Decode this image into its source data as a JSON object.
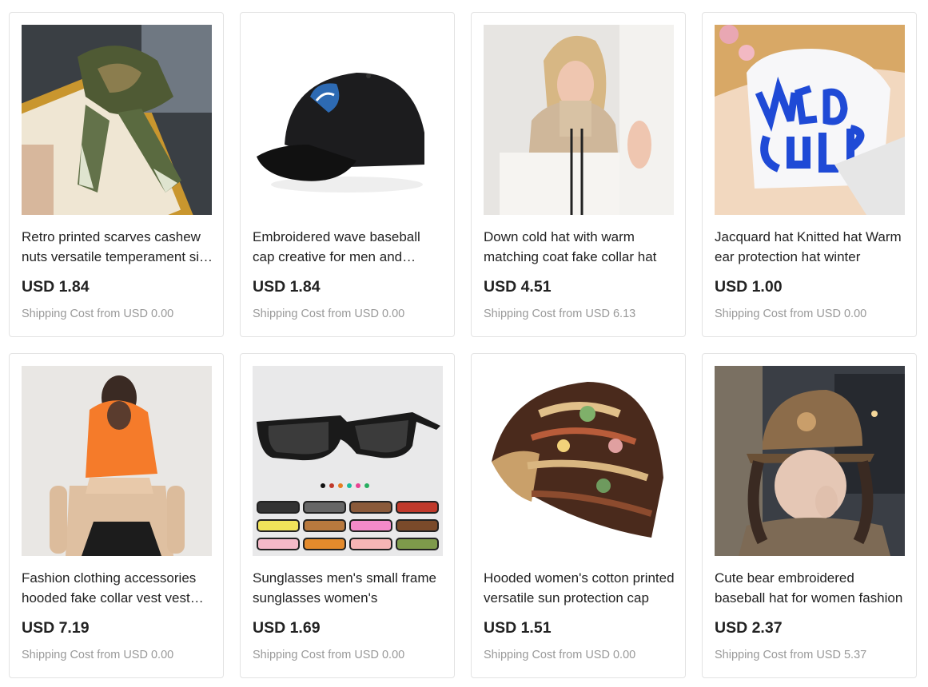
{
  "products": [
    {
      "title": "Retro printed scarves cashew nuts versatile temperament silk scarf",
      "price": "USD 1.84",
      "shipping": "Shipping Cost from USD 0.00"
    },
    {
      "title": "Embroidered wave baseball cap creative for men and women",
      "price": "USD 1.84",
      "shipping": "Shipping Cost from USD 0.00"
    },
    {
      "title": "Down cold hat with warm matching coat fake collar hat",
      "price": "USD 4.51",
      "shipping": "Shipping Cost from USD 6.13"
    },
    {
      "title": "Jacquard hat Knitted hat Warm ear protection hat winter",
      "price": "USD 1.00",
      "shipping": "Shipping Cost from USD 0.00"
    },
    {
      "title": "Fashion clothing accessories hooded fake collar vest vest scarf",
      "price": "USD 7.19",
      "shipping": "Shipping Cost from USD 0.00"
    },
    {
      "title": "Sunglasses men's small frame sunglasses women's",
      "price": "USD 1.69",
      "shipping": "Shipping Cost from USD 0.00"
    },
    {
      "title": "Hooded women's cotton printed versatile sun protection cap",
      "price": "USD 1.51",
      "shipping": "Shipping Cost from USD 0.00"
    },
    {
      "title": "Cute bear embroidered baseball hat for women fashion",
      "price": "USD 2.37",
      "shipping": "Shipping Cost from USD 5.37"
    }
  ]
}
